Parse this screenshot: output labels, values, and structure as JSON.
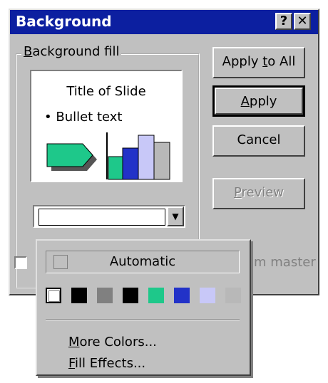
{
  "dialog": {
    "title": "Background",
    "help_button": "?",
    "close_button": "✕"
  },
  "fill_group": {
    "label": "Background fill",
    "preview_title": "Title of Slide",
    "preview_bullet": "Bullet text"
  },
  "buttons": {
    "apply_all": "Apply to All",
    "apply": "Apply",
    "cancel": "Cancel",
    "preview": "Preview"
  },
  "omit_label": "m master",
  "popup": {
    "automatic": "Automatic",
    "more_colors": "More Colors...",
    "fill_effects": "Fill Effects...",
    "swatches": [
      "#ffffff",
      "#000000",
      "#808080",
      "#000000",
      "#1ec88a",
      "#2232c8",
      "#c8c8f8",
      "#b8b8b8"
    ]
  },
  "colors": {
    "titlebar": "#0c1fa0",
    "face": "#c0c0c0",
    "preview_teal": "#1ec88a",
    "preview_blue": "#2232c8",
    "preview_lavender": "#c8c8f8",
    "preview_gray": "#b8b8b8"
  }
}
